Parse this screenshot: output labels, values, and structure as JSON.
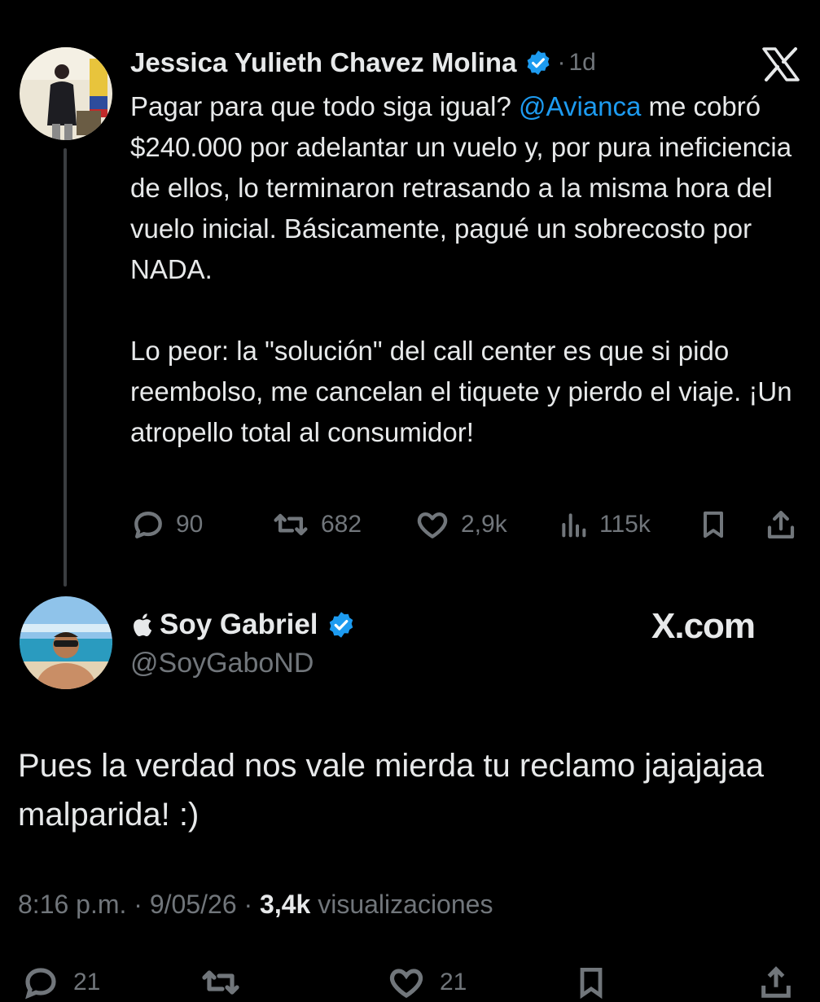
{
  "tweet": {
    "author_name": "Jessica Yulieth Chavez Molina",
    "time_sep": "·",
    "time": "1d",
    "text_p1_a": "Pagar para que todo siga igual? ",
    "mention": "@Avianca",
    "text_p1_b": " me cobró $240.000 por adelantar un vuelo y, por pura ineficiencia de ellos, lo terminaron retrasando a la misma hora del vuelo inicial. Básicamente, pagué un sobrecosto por NADA.",
    "text_p2": "Lo peor: la \"solución\" del call center es que si pido reembolso, me cancelan el tiquete y pierdo el viaje. ¡Un atropello total al consumidor!",
    "replies": "90",
    "retweets": "682",
    "likes": "2,9k",
    "views": "115k"
  },
  "reply": {
    "display_name": "Soy Gabriel",
    "handle": "@SoyGaboND",
    "watermark": "X.com",
    "text": "Pues la verdad nos vale mierda tu reclamo jajajajaa malparida! :)",
    "time": "8:16 p.m.",
    "sep1": "·",
    "date": "9/05/26",
    "sep2": "·",
    "views_count": "3,4k",
    "views_label": "visualizaciones",
    "bottom_counts": [
      "21",
      "",
      "21"
    ]
  },
  "icons": {
    "verified": "verified-badge-icon",
    "x_logo": "x-logo-icon",
    "apple": "apple-icon",
    "reply": "reply-icon",
    "retweet": "retweet-icon",
    "like": "heart-icon",
    "views": "views-icon",
    "bookmark": "bookmark-icon",
    "share": "share-icon"
  },
  "colors": {
    "background": "#000000",
    "text": "#e7e9ea",
    "muted": "#71767b",
    "link": "#1d9bf0",
    "verified": "#1d9bf0"
  }
}
